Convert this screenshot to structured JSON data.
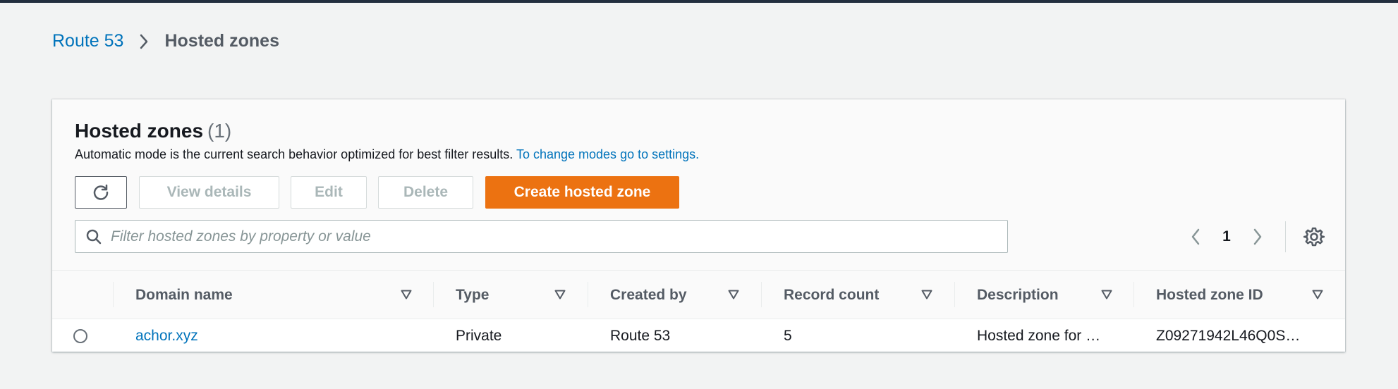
{
  "breadcrumb": {
    "root": "Route 53",
    "current": "Hosted zones"
  },
  "panel": {
    "title": "Hosted zones",
    "count": "(1)",
    "subtitle_text": "Automatic mode is the current search behavior optimized for best filter results.",
    "subtitle_link": "To change modes go to settings."
  },
  "toolbar": {
    "view_details": "View details",
    "edit": "Edit",
    "delete": "Delete",
    "create": "Create hosted zone"
  },
  "search": {
    "placeholder": "Filter hosted zones by property or value"
  },
  "pagination": {
    "page": "1"
  },
  "table": {
    "columns": [
      "Domain name",
      "Type",
      "Created by",
      "Record count",
      "Description",
      "Hosted zone ID"
    ],
    "rows": [
      {
        "domain": "achor.xyz",
        "type": "Private",
        "created_by": "Route 53",
        "record_count": "5",
        "description": "Hosted zone for …",
        "zone_id": "Z09271942L46Q0S…"
      }
    ]
  },
  "colors": {
    "accent_link": "#0073bb",
    "primary_button": "#ec7211",
    "background": "#f2f3f3"
  }
}
